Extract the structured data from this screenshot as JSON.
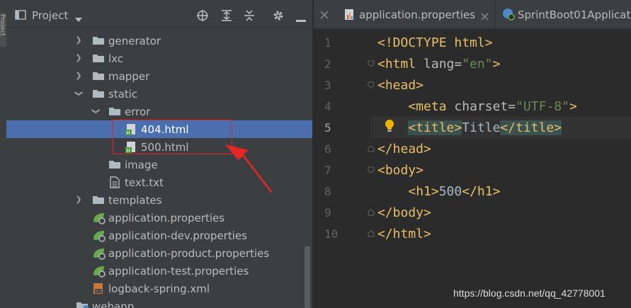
{
  "strip": {
    "label": "Project"
  },
  "project_panel": {
    "title": "Project",
    "header_icons": [
      "locate-icon",
      "expand-all-icon",
      "collapse-all-icon",
      "settings-icon",
      "hide-icon"
    ],
    "tree": [
      {
        "label": "generator",
        "type": "folder",
        "expanded": false
      },
      {
        "label": "lxc",
        "type": "folder",
        "expanded": false
      },
      {
        "label": "mapper",
        "type": "folder",
        "expanded": false
      },
      {
        "label": "static",
        "type": "folder",
        "expanded": true
      },
      {
        "label": "error",
        "type": "folder",
        "expanded": true
      },
      {
        "label": "404.html",
        "type": "html",
        "selected": true
      },
      {
        "label": "500.html",
        "type": "html"
      },
      {
        "label": "image",
        "type": "folder"
      },
      {
        "label": "text.txt",
        "type": "text"
      },
      {
        "label": "templates",
        "type": "folder",
        "expanded": false
      },
      {
        "label": "application.properties",
        "type": "properties"
      },
      {
        "label": "application-dev.properties",
        "type": "properties"
      },
      {
        "label": "application-product.properties",
        "type": "properties"
      },
      {
        "label": "application-test.properties",
        "type": "properties"
      },
      {
        "label": "logback-spring.xml",
        "type": "xml"
      },
      {
        "label": "webapp",
        "type": "folder"
      }
    ]
  },
  "editor": {
    "tabs": [
      {
        "label": "application.properties",
        "active": false
      },
      {
        "label": "SprintBoot01Applicat",
        "active": false
      }
    ],
    "current_line": 5,
    "lines": [
      {
        "n": "1",
        "text": "<!DOCTYPE html>"
      },
      {
        "n": "2",
        "text": "<html lang=\"en\">"
      },
      {
        "n": "3",
        "text": "<head>"
      },
      {
        "n": "4",
        "text": "    <meta charset=\"UTF-8\">"
      },
      {
        "n": "5",
        "text": "    <title>Title</title>"
      },
      {
        "n": "6",
        "text": "</head>"
      },
      {
        "n": "7",
        "text": "<body>"
      },
      {
        "n": "8",
        "text": "    <h1>500</h1>"
      },
      {
        "n": "9",
        "text": "</body>"
      },
      {
        "n": "10",
        "text": "</html>"
      }
    ]
  },
  "watermark": "https://blog.csdn.net/qq_42778001",
  "colors": {
    "panel_bg": "#3c3f41",
    "editor_bg": "#2b2b2b",
    "selection": "#4b6eaf",
    "tag": "#e8bf6a",
    "string": "#6a8759",
    "annotation_red": "#e32626"
  }
}
